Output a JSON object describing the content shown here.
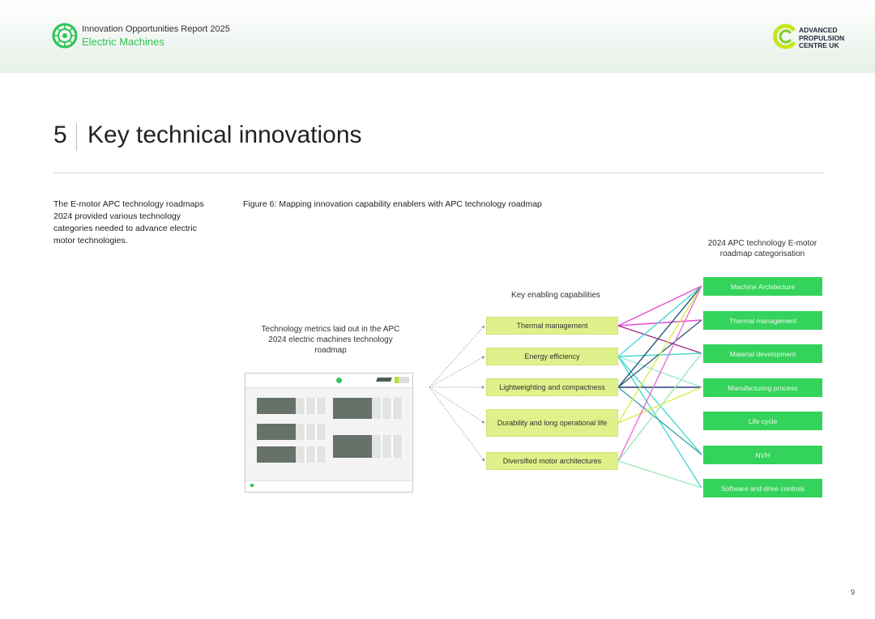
{
  "header": {
    "report_title": "Innovation Opportunities Report 2025",
    "report_subtitle": "Electric Machines",
    "org_lines": [
      "ADVANCED",
      "PROPULSION",
      "CENTRE UK"
    ]
  },
  "section": {
    "number": "5",
    "title": "Key technical innovations"
  },
  "intro_text": "The E-motor APC technology roadmaps 2024 provided various technology categories needed to advance electric motor technologies.",
  "figure": {
    "caption": "Figure 6: Mapping innovation capability enablers with APC technology roadmap",
    "metrics_heading": "Technology metrics laid out in the APC 2024 electric machines technology roadmap",
    "enablers_heading": "Key enabling capabilities",
    "categories_heading": "2024 APC technology E-motor roadmap categorisation",
    "enablers": [
      "Thermal management",
      "Energy efficiency",
      "Lightweighting and compactness",
      "Durability and long operational life",
      "Diversified motor architectures"
    ],
    "categories": [
      "Machine Architecture",
      "Thermal management",
      "Material development",
      "Manufacturing process",
      "Life cycle",
      "NVH",
      "Software and drive controls"
    ],
    "links": [
      {
        "from": 0,
        "to": 0,
        "color": "#e04fd3"
      },
      {
        "from": 0,
        "to": 1,
        "color": "#e04fd3"
      },
      {
        "from": 0,
        "to": 2,
        "color": "#a02b86"
      },
      {
        "from": 1,
        "to": 0,
        "color": "#48d9d1"
      },
      {
        "from": 1,
        "to": 2,
        "color": "#48d9d1"
      },
      {
        "from": 1,
        "to": 3,
        "color": "#9ee6dd"
      },
      {
        "from": 1,
        "to": 5,
        "color": "#48d9d1"
      },
      {
        "from": 1,
        "to": 6,
        "color": "#48d9d1"
      },
      {
        "from": 2,
        "to": 0,
        "color": "#2f5b76"
      },
      {
        "from": 2,
        "to": 1,
        "color": "#2f5b76"
      },
      {
        "from": 2,
        "to": 3,
        "color": "#2e3c7a"
      },
      {
        "from": 2,
        "to": 5,
        "color": "#3ca4a8"
      },
      {
        "from": 3,
        "to": 0,
        "color": "#d7ee4a"
      },
      {
        "from": 3,
        "to": 3,
        "color": "#d7ee4a"
      },
      {
        "from": 4,
        "to": 0,
        "color": "#e86fd8"
      },
      {
        "from": 4,
        "to": 2,
        "color": "#9de8b4"
      },
      {
        "from": 4,
        "to": 6,
        "color": "#9de8b4"
      }
    ],
    "colors": {
      "enabler_fill": "#dff18a",
      "category_fill": "#34d35b",
      "accent": "#2bc653"
    }
  },
  "page_number": "9"
}
